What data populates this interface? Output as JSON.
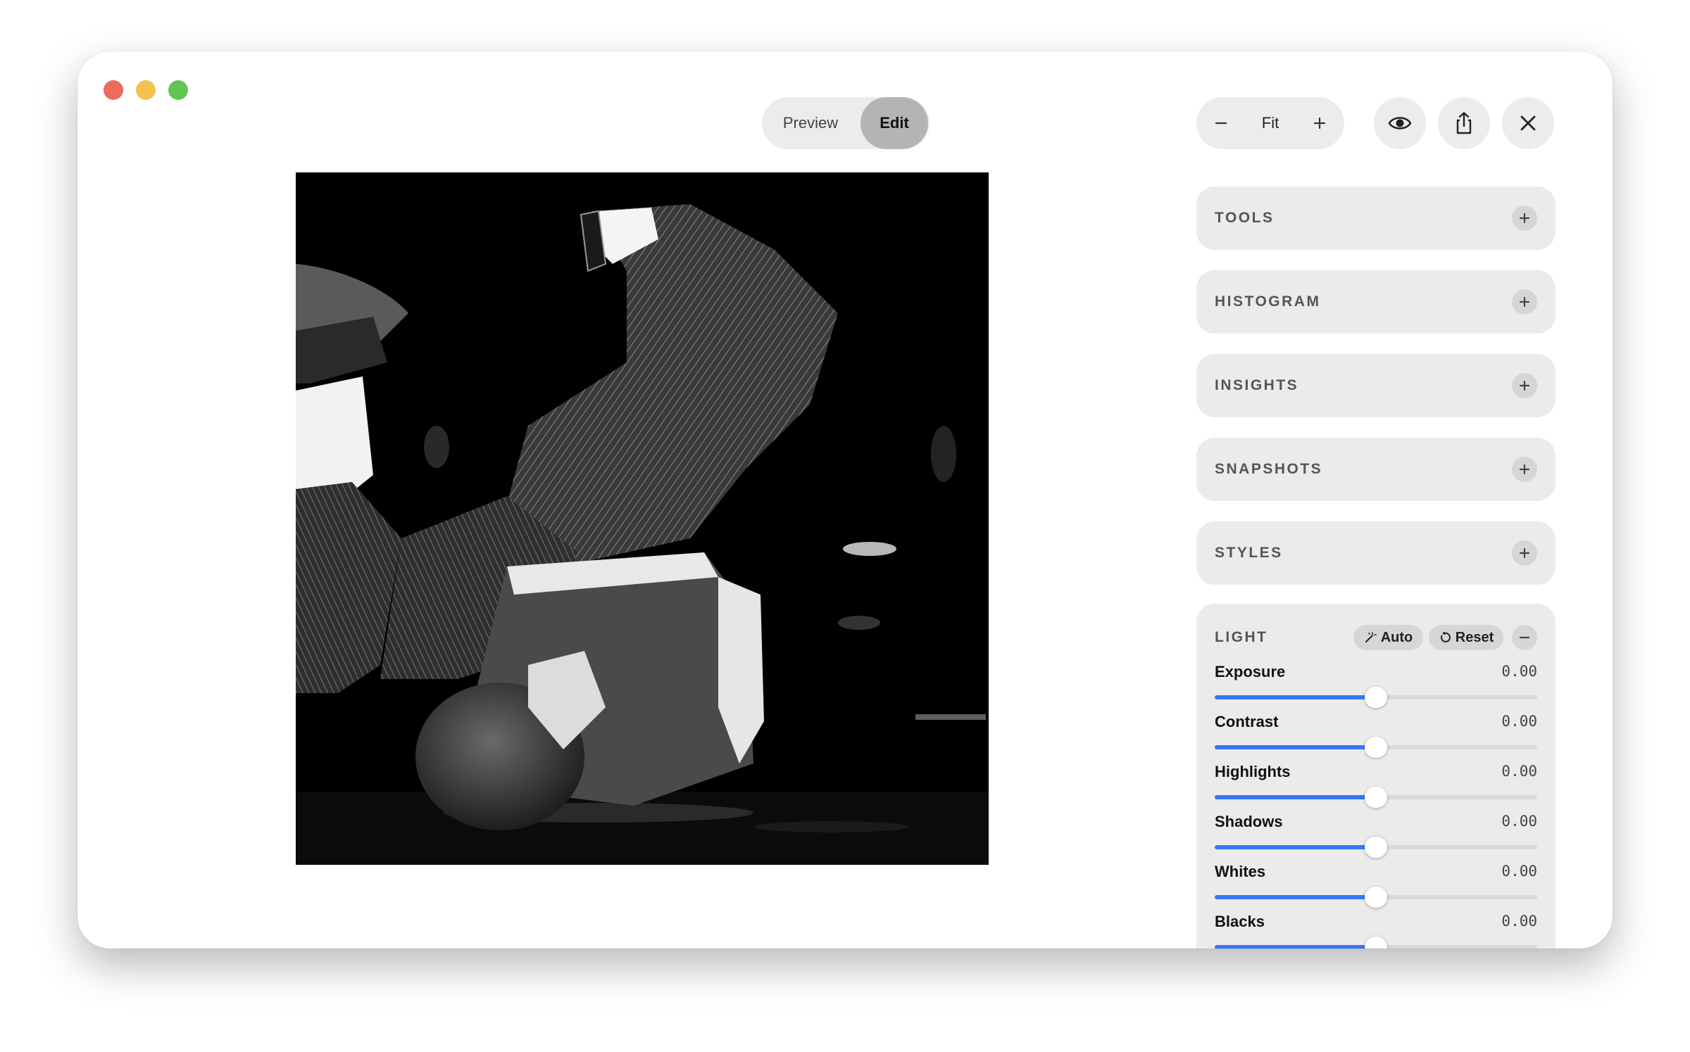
{
  "window": {
    "traffic_lights": [
      "close",
      "minimize",
      "maximize"
    ]
  },
  "toolbar": {
    "mode_preview": "Preview",
    "mode_edit": "Edit",
    "active_mode": "Edit",
    "zoom_label": "Fit",
    "icons": [
      "minus-icon",
      "plus-icon",
      "eye-icon",
      "share-icon",
      "close-icon"
    ]
  },
  "panel": {
    "sections": [
      {
        "label": "TOOLS"
      },
      {
        "label": "HISTOGRAM"
      },
      {
        "label": "INSIGHTS"
      },
      {
        "label": "SNAPSHOTS"
      },
      {
        "label": "STYLES"
      }
    ],
    "light": {
      "title": "LIGHT",
      "auto_label": "Auto",
      "reset_label": "Reset",
      "sliders": [
        {
          "label": "Exposure",
          "value": "0.00",
          "position": 0.5
        },
        {
          "label": "Contrast",
          "value": "0.00",
          "position": 0.5
        },
        {
          "label": "Highlights",
          "value": "0.00",
          "position": 0.5
        },
        {
          "label": "Shadows",
          "value": "0.00",
          "position": 0.5
        },
        {
          "label": "Whites",
          "value": "0.00",
          "position": 0.5
        },
        {
          "label": "Blacks",
          "value": "0.00",
          "position": 0.5
        }
      ]
    }
  },
  "colors": {
    "accent": "#3478f6",
    "panel_bg": "#ebebeb",
    "close": "#ec6a5e",
    "minimize": "#f4c04f",
    "maximize": "#61c554"
  }
}
